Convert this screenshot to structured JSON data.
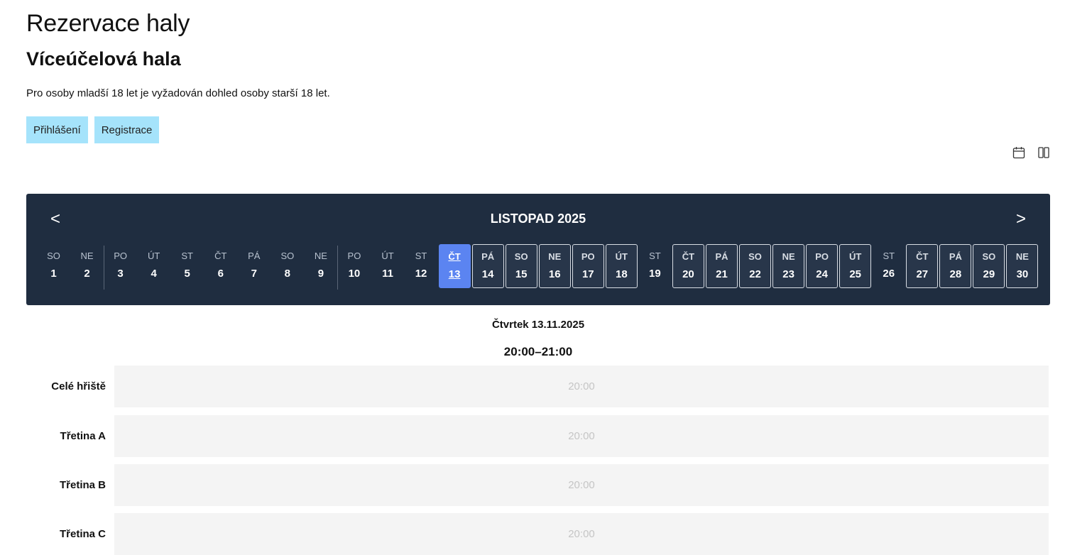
{
  "page": {
    "title": "Rezervace haly",
    "hall_title": "Víceúčelová hala",
    "notice": "Pro osoby mladší 18 let je vyžadován dohled osoby starší 18 let."
  },
  "auth": {
    "login_label": "Přihlášení",
    "register_label": "Registrace"
  },
  "view_icons": [
    "calendar-icon",
    "columns-icon"
  ],
  "calendar": {
    "prev": "<",
    "next": ">",
    "month_title": "LISTOPAD 2025",
    "days": [
      {
        "name": "SO",
        "num": "1",
        "state": "plain"
      },
      {
        "name": "NE",
        "num": "2",
        "state": "plain"
      },
      {
        "name": "PO",
        "num": "3",
        "state": "plain"
      },
      {
        "name": "ÚT",
        "num": "4",
        "state": "plain"
      },
      {
        "name": "ST",
        "num": "5",
        "state": "plain"
      },
      {
        "name": "ČT",
        "num": "6",
        "state": "plain"
      },
      {
        "name": "PÁ",
        "num": "7",
        "state": "plain"
      },
      {
        "name": "SO",
        "num": "8",
        "state": "plain"
      },
      {
        "name": "NE",
        "num": "9",
        "state": "plain"
      },
      {
        "name": "PO",
        "num": "10",
        "state": "plain"
      },
      {
        "name": "ÚT",
        "num": "11",
        "state": "plain"
      },
      {
        "name": "ST",
        "num": "12",
        "state": "plain"
      },
      {
        "name": "ČT",
        "num": "13",
        "state": "selected"
      },
      {
        "name": "PÁ",
        "num": "14",
        "state": "avail"
      },
      {
        "name": "SO",
        "num": "15",
        "state": "avail"
      },
      {
        "name": "NE",
        "num": "16",
        "state": "avail"
      },
      {
        "name": "PO",
        "num": "17",
        "state": "avail"
      },
      {
        "name": "ÚT",
        "num": "18",
        "state": "avail"
      },
      {
        "name": "ST",
        "num": "19",
        "state": "plain"
      },
      {
        "name": "ČT",
        "num": "20",
        "state": "avail"
      },
      {
        "name": "PÁ",
        "num": "21",
        "state": "avail"
      },
      {
        "name": "SO",
        "num": "22",
        "state": "avail"
      },
      {
        "name": "NE",
        "num": "23",
        "state": "avail"
      },
      {
        "name": "PO",
        "num": "24",
        "state": "avail"
      },
      {
        "name": "ÚT",
        "num": "25",
        "state": "avail"
      },
      {
        "name": "ST",
        "num": "26",
        "state": "plain"
      },
      {
        "name": "ČT",
        "num": "27",
        "state": "avail"
      },
      {
        "name": "PÁ",
        "num": "28",
        "state": "avail"
      },
      {
        "name": "SO",
        "num": "29",
        "state": "avail"
      },
      {
        "name": "NE",
        "num": "30",
        "state": "avail"
      }
    ]
  },
  "schedule": {
    "date_label": "Čtvrtek 13.11.2025",
    "time_range": "20:00–21:00",
    "courts": [
      {
        "name": "Celé hřiště",
        "slot": "20:00"
      },
      {
        "name": "Třetina A",
        "slot": "20:00"
      },
      {
        "name": "Třetina B",
        "slot": "20:00"
      },
      {
        "name": "Třetina C",
        "slot": "20:00"
      }
    ]
  },
  "colors": {
    "calendar_bg": "#1f2d40",
    "selected_day": "#5b84f1",
    "auth_button": "#a5e3fb",
    "slot_bg": "#f4f4f4"
  }
}
